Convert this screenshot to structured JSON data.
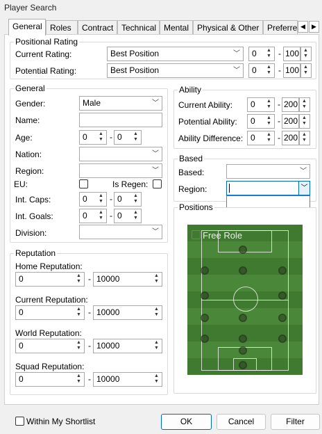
{
  "window": {
    "title": "Player Search"
  },
  "tabs": [
    "General",
    "Roles",
    "Contract",
    "Technical",
    "Mental",
    "Physical & Other",
    "Preferre"
  ],
  "positional_rating": {
    "title": "Positional Rating",
    "current_label": "Current Rating:",
    "current_value": "Best Position",
    "current_min": "0",
    "current_max": "100",
    "potential_label": "Potential Rating:",
    "potential_value": "Best Position",
    "potential_min": "0",
    "potential_max": "100"
  },
  "general": {
    "title": "General",
    "gender_label": "Gender:",
    "gender_value": "Male",
    "name_label": "Name:",
    "name_value": "",
    "age_label": "Age:",
    "age_min": "0",
    "age_max": "0",
    "nation_label": "Nation:",
    "nation_value": "",
    "region_label": "Region:",
    "region_value": "",
    "eu_label": "EU:",
    "regen_label": "Is Regen:",
    "caps_label": "Int. Caps:",
    "caps_min": "0",
    "caps_max": "0",
    "goals_label": "Int. Goals:",
    "goals_min": "0",
    "goals_max": "0",
    "division_label": "Division:",
    "division_value": ""
  },
  "ability": {
    "title": "Ability",
    "ca_label": "Current Ability:",
    "ca_min": "0",
    "ca_max": "200",
    "pa_label": "Potential Ability:",
    "pa_min": "0",
    "pa_max": "200",
    "diff_label": "Ability Difference:",
    "diff_min": "0",
    "diff_max": "200"
  },
  "based": {
    "title": "Based",
    "based_label": "Based:",
    "based_value": "",
    "region_label": "Region:",
    "region_value": ""
  },
  "positions": {
    "title": "Positions",
    "free_role": "Free Role"
  },
  "reputation": {
    "title": "Reputation",
    "home_label": "Home Reputation:",
    "home_min": "0",
    "home_max": "10000",
    "current_label": "Current Reputation:",
    "current_min": "0",
    "current_max": "10000",
    "world_label": "World Reputation:",
    "world_min": "0",
    "world_max": "10000",
    "squad_label": "Squad Reputation:",
    "squad_min": "0",
    "squad_max": "10000"
  },
  "footer": {
    "shortlist_label": "Within My Shortlist",
    "ok_label": "OK",
    "cancel_label": "Cancel",
    "filter_label": "Filter"
  },
  "colors": {
    "accent": "#0067c0",
    "pitch": "#3f7a30"
  }
}
